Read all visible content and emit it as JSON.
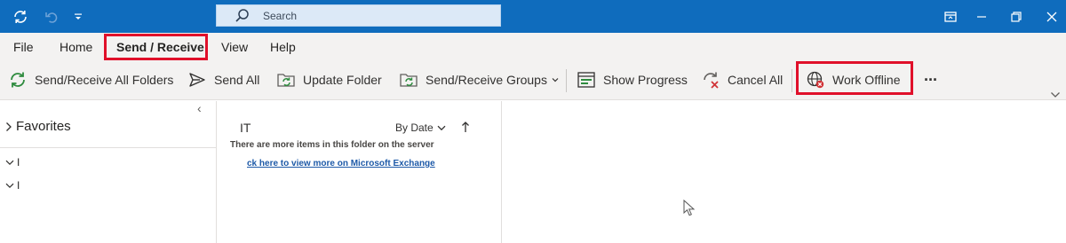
{
  "title_bar": {
    "search_placeholder": "Search",
    "icons": [
      "sync-icon",
      "undo-icon",
      "customize-qat-icon",
      "search-icon",
      "ribbon-display-icon",
      "restore-icon",
      "close-icon"
    ],
    "accent": "#0f6cbd"
  },
  "menu": {
    "items": [
      {
        "label": "File"
      },
      {
        "label": "Home"
      },
      {
        "label": "Send / Receive",
        "active": true
      },
      {
        "label": "View"
      },
      {
        "label": "Help"
      }
    ]
  },
  "ribbon": {
    "buttons": [
      {
        "label": "Send/Receive All Folders",
        "icon": "sync-all-icon"
      },
      {
        "label": "Send All",
        "icon": "send-icon"
      },
      {
        "label": "Update Folder",
        "icon": "update-folder-icon"
      },
      {
        "label": "Send/Receive Groups",
        "icon": "groups-icon",
        "dropdown": true
      },
      {
        "label": "Show Progress",
        "icon": "progress-icon"
      },
      {
        "label": "Cancel All",
        "icon": "cancel-all-icon"
      },
      {
        "label": "Work Offline",
        "icon": "work-offline-icon"
      }
    ],
    "more_label": "···"
  },
  "folder_pane": {
    "favorites_label": "Favorites",
    "collapse_glyph": "‹",
    "accounts": [
      "I",
      "I"
    ]
  },
  "message_list": {
    "folder_name": "IT",
    "sort_label": "By Date",
    "notice": "There are more items in this folder on the server",
    "link": "ck here to view more on Microsoft Exchange"
  },
  "highlight_color": "#e0102a"
}
